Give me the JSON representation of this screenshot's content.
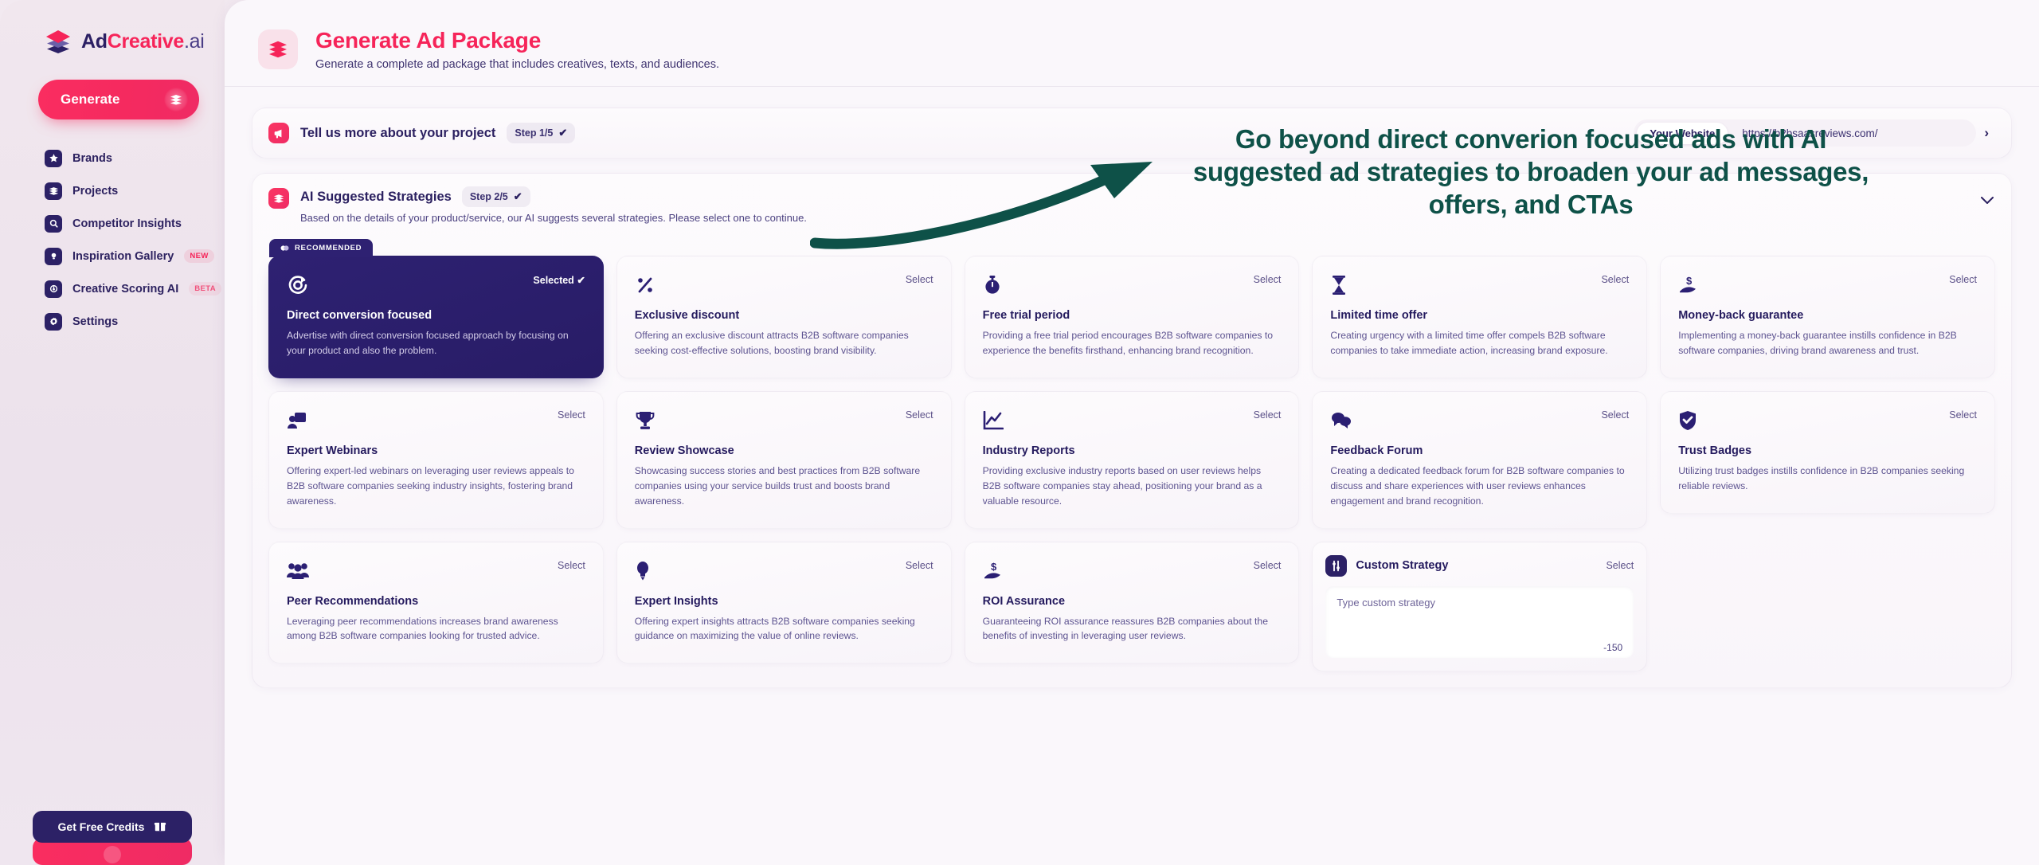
{
  "brand": {
    "logo_part1": "Ad",
    "logo_part2": "Creative",
    "logo_part3": ".ai",
    "accent_pink": "#f62459",
    "accent_indigo": "#2c2166",
    "annotation_green": "#0e5148"
  },
  "sidebar": {
    "generate_button": "Generate",
    "items": [
      {
        "label": "Brands",
        "icon": "star-icon",
        "badge": null
      },
      {
        "label": "Projects",
        "icon": "layers-icon",
        "badge": null
      },
      {
        "label": "Competitor Insights",
        "icon": "search-icon",
        "badge": null
      },
      {
        "label": "Inspiration Gallery",
        "icon": "lightbulb-icon",
        "badge": "NEW"
      },
      {
        "label": "Creative Scoring AI",
        "icon": "gauge-icon",
        "badge": "BETA"
      },
      {
        "label": "Settings",
        "icon": "gear-icon",
        "badge": null
      }
    ],
    "credits_button": "Get Free Credits"
  },
  "header": {
    "title": "Generate Ad Package",
    "subtitle": "Generate a complete ad package that includes creatives, texts, and audiences.",
    "icon": "layers-icon"
  },
  "step1": {
    "title": "Tell us more about your project",
    "badge": "Step 1/5",
    "badge_check": "✔",
    "icon": "megaphone-icon",
    "website_label": "Your Website",
    "website_value": "https://b2bsaasreviews.com/",
    "expand_chevron": "›"
  },
  "step2": {
    "title": "AI Suggested Strategies",
    "badge": "Step 2/5",
    "badge_check": "✔",
    "icon": "layers-icon",
    "description": "Based on the details of your product/service, our AI suggests several strategies. Please select one to continue.",
    "collapse_chevron": "⌄"
  },
  "annotation": {
    "text": "Go beyond direct converion focused ads with AI suggested ad strategies to broaden your ad messages, offers, and CTAs"
  },
  "labels": {
    "select": "Select",
    "selected": "Selected",
    "selected_check": "✔",
    "recommended": "RECOMMENDED"
  },
  "strategies": [
    {
      "title": "Direct conversion focused",
      "description": "Advertise with direct conversion focused approach by focusing on your product and also the problem.",
      "icon": "target-icon",
      "state": "Selected",
      "recommended": true
    },
    {
      "title": "Exclusive discount",
      "description": "Offering an exclusive discount attracts B2B software companies seeking cost-effective solutions, boosting brand visibility.",
      "icon": "percent-icon",
      "state": "Select",
      "recommended": false
    },
    {
      "title": "Free trial period",
      "description": "Providing a free trial period encourages B2B software companies to experience the benefits firsthand, enhancing brand recognition.",
      "icon": "stopwatch-icon",
      "state": "Select",
      "recommended": false
    },
    {
      "title": "Limited time offer",
      "description": "Creating urgency with a limited time offer compels B2B software companies to take immediate action, increasing brand exposure.",
      "icon": "hourglass-icon",
      "state": "Select",
      "recommended": false
    },
    {
      "title": "Money-back guarantee",
      "description": "Implementing a money-back guarantee instills confidence in B2B software companies, driving brand awareness and trust.",
      "icon": "hand-money-icon",
      "state": "Select",
      "recommended": false
    },
    {
      "title": "Expert Webinars",
      "description": "Offering expert-led webinars on leveraging user reviews appeals to B2B software companies seeking industry insights, fostering brand awareness.",
      "icon": "presentation-icon",
      "state": "Select",
      "recommended": false
    },
    {
      "title": "Review Showcase",
      "description": "Showcasing success stories and best practices from B2B software companies using your service builds trust and boosts brand awareness.",
      "icon": "trophy-icon",
      "state": "Select",
      "recommended": false
    },
    {
      "title": "Industry Reports",
      "description": "Providing exclusive industry reports based on user reviews helps B2B software companies stay ahead, positioning your brand as a valuable resource.",
      "icon": "line-chart-icon",
      "state": "Select",
      "recommended": false
    },
    {
      "title": "Feedback Forum",
      "description": "Creating a dedicated feedback forum for B2B software companies to discuss and share experiences with user reviews enhances engagement and brand recognition.",
      "icon": "chat-bubbles-icon",
      "state": "Select",
      "recommended": false
    },
    {
      "title": "Trust Badges",
      "description": "Utilizing trust badges instills confidence in B2B companies seeking reliable reviews.",
      "icon": "shield-check-icon",
      "state": "Select",
      "recommended": false
    },
    {
      "title": "Peer Recommendations",
      "description": "Leveraging peer recommendations increases brand awareness among B2B software companies looking for trusted advice.",
      "icon": "people-icon",
      "state": "Select",
      "recommended": false
    },
    {
      "title": "Expert Insights",
      "description": "Offering expert insights attracts B2B software companies seeking guidance on maximizing the value of online reviews.",
      "icon": "lightbulb-icon",
      "state": "Select",
      "recommended": false
    },
    {
      "title": "ROI Assurance",
      "description": "Guaranteeing ROI assurance reassures B2B companies about the benefits of investing in leveraging user reviews.",
      "icon": "hand-money-icon",
      "state": "Select",
      "recommended": false
    }
  ],
  "custom_strategy": {
    "title": "Custom Strategy",
    "select_label": "Select",
    "placeholder": "Type custom strategy",
    "char_count": "-150",
    "icon": "sliders-icon"
  }
}
